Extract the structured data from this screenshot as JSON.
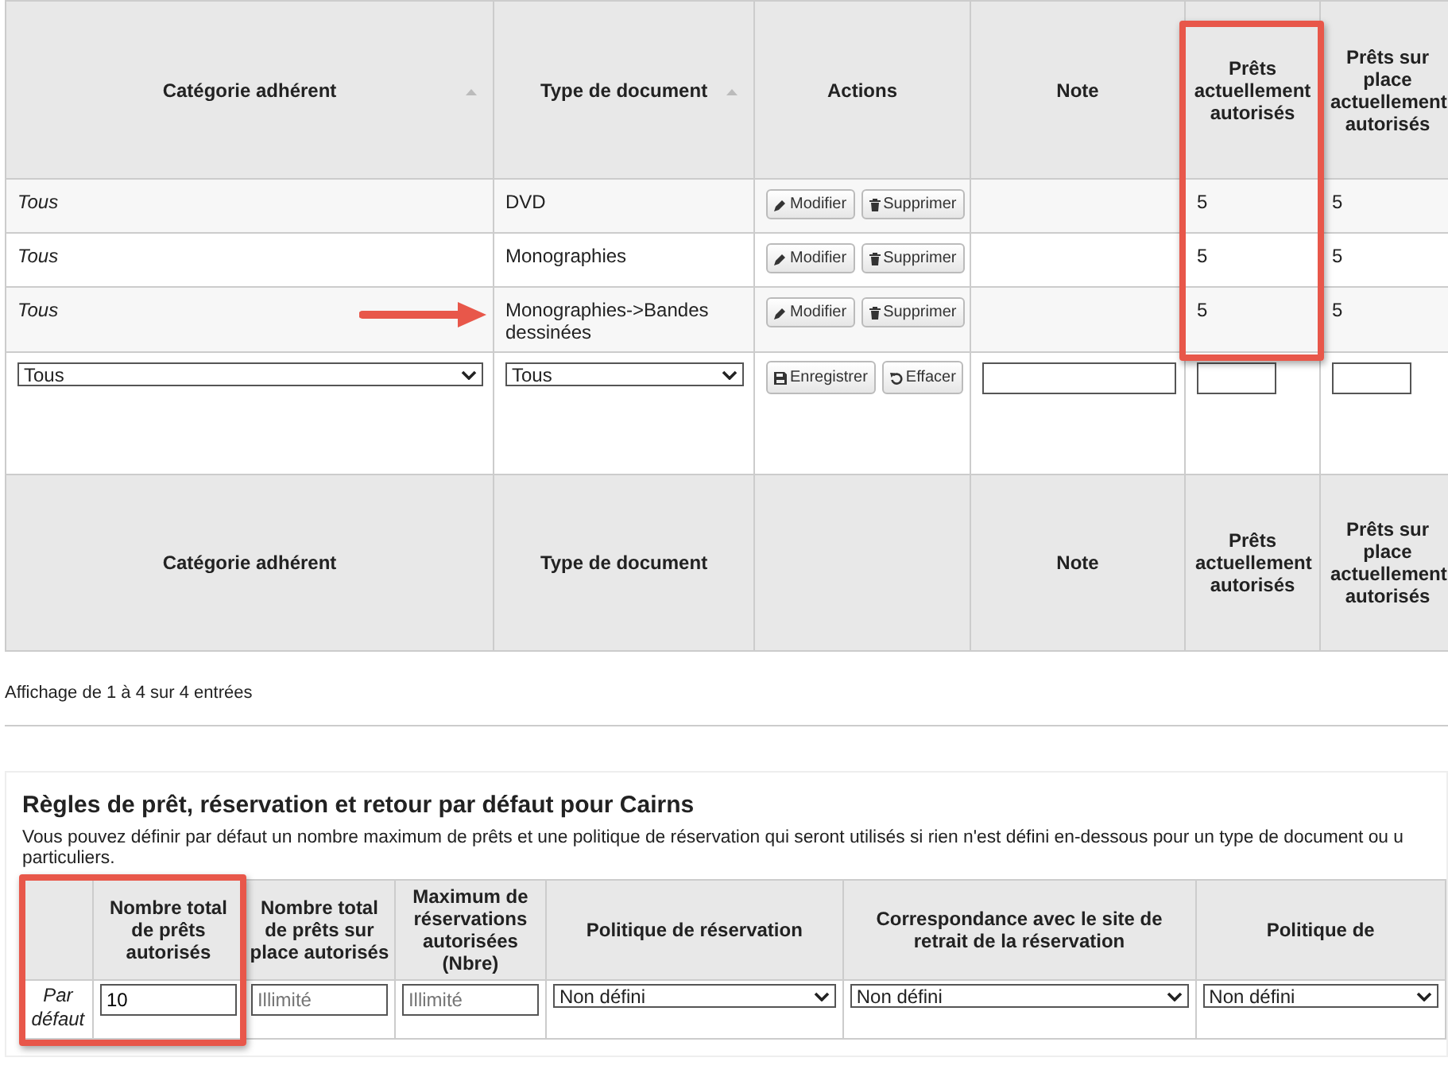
{
  "rules_table": {
    "columns": [
      {
        "label": "Catégorie adhérent",
        "sortable": true,
        "highlighted": false
      },
      {
        "label": "Type de document",
        "sortable": true,
        "highlighted": false
      },
      {
        "label": "Actions",
        "sortable": false,
        "highlighted": false
      },
      {
        "label": "Note",
        "sortable": false,
        "highlighted": false
      },
      {
        "label": "Prêts actuellement autorisés",
        "sortable": false,
        "highlighted": true
      },
      {
        "label": "Prêts sur place actuellement autorisés",
        "sortable": false,
        "highlighted": false
      }
    ],
    "rows": [
      {
        "category": "Tous",
        "document_type": "DVD",
        "buttons": [
          "Modifier",
          "Supprimer"
        ],
        "loans": "5",
        "onsite_loans": "5",
        "marked": false
      },
      {
        "category": "Tous",
        "document_type": "Monographies",
        "buttons": [
          "Modifier",
          "Supprimer"
        ],
        "loans": "5",
        "onsite_loans": "5",
        "marked": false
      },
      {
        "category": "Tous",
        "document_type": "Monographies->Bandes dessinées",
        "buttons": [
          "Modifier",
          "Supprimer"
        ],
        "loans": "5",
        "onsite_loans": "5",
        "marked": true
      }
    ],
    "form_row": {
      "category_select": "Tous",
      "type_select": "Tous",
      "buttons": [
        {
          "label": "Enregistrer",
          "kind": "save"
        },
        {
          "label": "Effacer",
          "kind": "clear"
        }
      ]
    },
    "footer": [
      {
        "kind": "label",
        "label": "Catégorie adhérent"
      },
      {
        "kind": "label",
        "label": "Type de document"
      },
      {
        "kind": "blank"
      },
      {
        "kind": "label",
        "label": "Note"
      },
      {
        "kind": "label",
        "label": "Prêts actuellement autorisés"
      },
      {
        "kind": "label",
        "label": "Prêts sur place actuellement autorisés"
      }
    ]
  },
  "info": "Affichage de 1 à 4 sur 4 entrées",
  "defaults_section": {
    "title": "Règles de prêt, réservation et retour par défaut pour Cairns",
    "description": [
      "Vous pouvez définir par défaut un nombre maximum de prêts et une politique de réservation qui seront utilisés si rien n'est défini en-dessous pour un type de document ou u",
      "particuliers."
    ],
    "columns": [
      {
        "kind": "blank",
        "highlighted": true
      },
      {
        "kind": "label",
        "label": "Nombre total de prêts autorisés",
        "highlighted": true
      },
      {
        "kind": "label",
        "label": "Nombre total de prêts sur place autorisés",
        "highlighted": false
      },
      {
        "kind": "label",
        "label": "Maximum de réservations autorisées (Nbre)",
        "highlighted": false
      },
      {
        "kind": "label",
        "label": "Politique de réservation",
        "highlighted": false
      },
      {
        "kind": "label",
        "label": "Correspondance avec le site de retrait de la réservation",
        "highlighted": false
      },
      {
        "kind": "label",
        "label": "Politique de",
        "highlighted": false
      }
    ],
    "row": {
      "label": "Par défaut",
      "cells": [
        {
          "kind": "input",
          "value": "10"
        },
        {
          "kind": "input",
          "placeholder": "Illimité"
        },
        {
          "kind": "input",
          "placeholder": "Illimité"
        },
        {
          "kind": "select",
          "value": "Non défini"
        },
        {
          "kind": "select",
          "value": "Non défini"
        },
        {
          "kind": "select",
          "value": "Non défini"
        }
      ]
    }
  }
}
